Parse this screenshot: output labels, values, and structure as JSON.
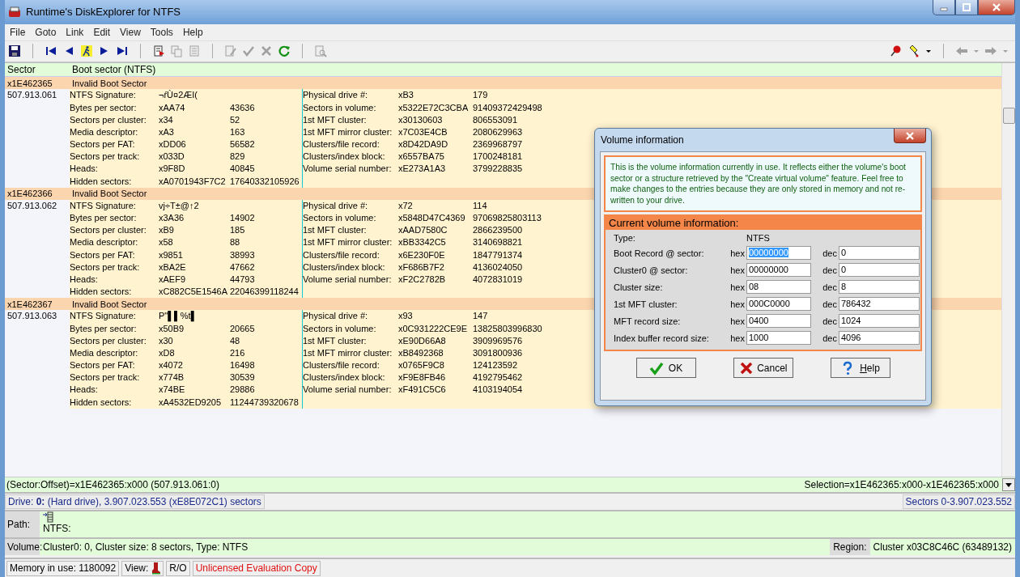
{
  "window": {
    "title": "Runtime's DiskExplorer for NTFS"
  },
  "menu": [
    "File",
    "Goto",
    "Link",
    "Edit",
    "View",
    "Tools",
    "Help"
  ],
  "toolbar": [
    {
      "kind": "save",
      "disabled": false
    },
    {
      "kind": "sep"
    },
    {
      "kind": "first",
      "disabled": false
    },
    {
      "kind": "previous",
      "disabled": false
    },
    {
      "kind": "walker",
      "disabled": false
    },
    {
      "kind": "next",
      "disabled": false
    },
    {
      "kind": "last",
      "disabled": false
    },
    {
      "kind": "sep"
    },
    {
      "kind": "flag-document",
      "disabled": false
    },
    {
      "kind": "copy",
      "disabled": true
    },
    {
      "kind": "grid-document",
      "disabled": true
    },
    {
      "kind": "sep"
    },
    {
      "kind": "edit-document",
      "disabled": true
    },
    {
      "kind": "check",
      "disabled": true
    },
    {
      "kind": "cross",
      "disabled": true
    },
    {
      "kind": "refresh",
      "disabled": false
    },
    {
      "kind": "sep"
    },
    {
      "kind": "search-document",
      "disabled": true
    }
  ],
  "toolbar_right": [
    {
      "kind": "pushpin",
      "disabled": false
    },
    {
      "kind": "marker",
      "disabled": false
    },
    {
      "kind": "caret",
      "disabled": false
    },
    {
      "kind": "sep"
    },
    {
      "kind": "back",
      "disabled": true
    },
    {
      "kind": "caret",
      "disabled": true
    },
    {
      "kind": "forward",
      "disabled": true
    },
    {
      "kind": "caret",
      "disabled": true
    }
  ],
  "table": {
    "columns": [
      "Sector",
      "Boot sector (NTFS)"
    ],
    "groups": [
      {
        "sector_hex": "x1E462365",
        "status": "Invalid Boot Sector",
        "sector_dec": "507.913.061",
        "left": [
          {
            "label": "NTFS Signature:",
            "hex": "¬ŕÙ¤2ÆI("
          },
          {
            "label": "Bytes per sector:",
            "hex": "xAA74",
            "dec": "43636"
          },
          {
            "label": "Sectors per cluster:",
            "hex": "x34",
            "dec": "52"
          },
          {
            "label": "Media descriptor:",
            "hex": "xA3",
            "dec": "163"
          },
          {
            "label": "Sectors per FAT:",
            "hex": "xDD06",
            "dec": "56582"
          },
          {
            "label": "Sectors per track:",
            "hex": "x033D",
            "dec": "829"
          },
          {
            "label": "Heads:",
            "hex": "x9F8D",
            "dec": "40845"
          },
          {
            "label": "Hidden sectors:",
            "hex": "xA0701943F7C2",
            "dec": "17640332105926"
          }
        ],
        "right": [
          {
            "label": "Physical drive #:",
            "hex": "xB3",
            "dec": "179"
          },
          {
            "label": "Sectors in volume:",
            "hex": "x5322E72C3CBA",
            "dec": "91409372429498"
          },
          {
            "label": "1st MFT cluster:",
            "hex": "x30130603",
            "dec": "806553091"
          },
          {
            "label": "1st MFT mirror cluster:",
            "hex": "x7C03E4CB",
            "dec": "2080629963"
          },
          {
            "label": "Clusters/file record:",
            "hex": "x8D42DA9D",
            "dec": "2369968797"
          },
          {
            "label": "Clusters/index block:",
            "hex": "x6557BA75",
            "dec": "1700248181"
          },
          {
            "label": "Volume serial number:",
            "hex": "xE273A1A3",
            "dec": "3799228835"
          }
        ]
      },
      {
        "sector_hex": "x1E462366",
        "status": "Invalid Boot Sector",
        "sector_dec": "507.913.062",
        "left": [
          {
            "label": "NTFS Signature:",
            "hex": "vj÷T±@↑2"
          },
          {
            "label": "Bytes per sector:",
            "hex": "x3A36",
            "dec": "14902"
          },
          {
            "label": "Sectors per cluster:",
            "hex": "xB9",
            "dec": "185"
          },
          {
            "label": "Media descriptor:",
            "hex": "x58",
            "dec": "88"
          },
          {
            "label": "Sectors per FAT:",
            "hex": "x9851",
            "dec": "38993"
          },
          {
            "label": "Sectors per track:",
            "hex": "xBA2E",
            "dec": "47662"
          },
          {
            "label": "Heads:",
            "hex": "xAEF9",
            "dec": "44793"
          },
          {
            "label": "Hidden sectors:",
            "hex": "xC882C5E1546A",
            "dec": "22046399118244"
          }
        ],
        "right": [
          {
            "label": "Physical drive #:",
            "hex": "x72",
            "dec": "114"
          },
          {
            "label": "Sectors in volume:",
            "hex": "x5848D47C4369",
            "dec": "97069825803113"
          },
          {
            "label": "1st MFT cluster:",
            "hex": "xAAD7580C",
            "dec": "2866239500"
          },
          {
            "label": "1st MFT mirror cluster:",
            "hex": "xBB3342C5",
            "dec": "3140698821"
          },
          {
            "label": "Clusters/file record:",
            "hex": "x6E230F0E",
            "dec": "1847791374"
          },
          {
            "label": "Clusters/index block:",
            "hex": "xF686B7F2",
            "dec": "4136024050"
          },
          {
            "label": "Volume serial number:",
            "hex": "xF2C2782B",
            "dec": "4072831019"
          }
        ]
      },
      {
        "sector_hex": "x1E462367",
        "status": "Invalid Boot Sector",
        "sector_dec": "507.913.063",
        "left": [
          {
            "label": "NTFS Signature:",
            "hex": "P\"▌▌%t▌"
          },
          {
            "label": "Bytes per sector:",
            "hex": "x50B9",
            "dec": "20665"
          },
          {
            "label": "Sectors per cluster:",
            "hex": "x30",
            "dec": "48"
          },
          {
            "label": "Media descriptor:",
            "hex": "xD8",
            "dec": "216"
          },
          {
            "label": "Sectors per FAT:",
            "hex": "x4072",
            "dec": "16498"
          },
          {
            "label": "Sectors per track:",
            "hex": "x774B",
            "dec": "30539"
          },
          {
            "label": "Heads:",
            "hex": "x74BE",
            "dec": "29886"
          },
          {
            "label": "Hidden sectors:",
            "hex": "xA4532ED9205",
            "dec": "11244739320678"
          }
        ],
        "right": [
          {
            "label": "Physical drive #:",
            "hex": "x93",
            "dec": "147"
          },
          {
            "label": "Sectors in volume:",
            "hex": "x0C931222CE9E",
            "dec": "13825803996830"
          },
          {
            "label": "1st MFT cluster:",
            "hex": "xE90D66A8",
            "dec": "3909969576"
          },
          {
            "label": "1st MFT mirror cluster:",
            "hex": "xB8492368",
            "dec": "3091800936"
          },
          {
            "label": "Clusters/file record:",
            "hex": "x0765F9C8",
            "dec": "124123592"
          },
          {
            "label": "Clusters/index block:",
            "hex": "xF9E8FB46",
            "dec": "4192795462"
          },
          {
            "label": "Volume serial number:",
            "hex": "xF491C5C6",
            "dec": "4103194054"
          }
        ]
      }
    ]
  },
  "position": {
    "offset": "(Sector:Offset)=x1E462365:x000 (507.913.061:0)",
    "selection": "Selection=x1E462365:x000-x1E462365:x000"
  },
  "drive": {
    "label": "Drive:",
    "number": "0:",
    "info": "(Hard drive), 3.907.023.553 (xE8E072C1) sectors",
    "range": "Sectors 0-3.907.023.552"
  },
  "path": {
    "label": "Path:",
    "value": "NTFS:"
  },
  "volume": {
    "label": "Volume:",
    "value": "Cluster0: 0, Cluster size: 8 sectors, Type: NTFS",
    "region_label": "Region:",
    "region": "Cluster x03C8C46C (63489132)"
  },
  "status_bar": {
    "memory": "Memory in use: 1180092",
    "view": "View:",
    "mode": "R/O",
    "license": "Unlicensed Evaluation Copy"
  },
  "dialog": {
    "title": "Volume information",
    "intro": "This is the volume information currently in use. It reflects either the volume's boot sector or a structure retrieved by the \"Create virtual volume\" feature. Feel free to make changes to the entries because they are only stored in memory and not re-written to your drive.",
    "section": "Current volume information:",
    "type_label": "Type:",
    "type_value": "NTFS",
    "rows": [
      {
        "label": "Boot Record @ sector:",
        "hex_label": "hex",
        "hex": "00000000",
        "dec_label": "dec",
        "dec": "0",
        "selected": true
      },
      {
        "label": "Cluster0 @ sector:",
        "hex_label": "hex",
        "hex": "00000000",
        "dec_label": "dec",
        "dec": "0",
        "selected": false
      },
      {
        "label": "Cluster size:",
        "hex_label": "hex",
        "hex": "08",
        "dec_label": "dec",
        "dec": "8",
        "selected": false
      },
      {
        "label": "1st MFT cluster:",
        "hex_label": "hex",
        "hex": "000C0000",
        "dec_label": "dec",
        "dec": "786432",
        "selected": false
      },
      {
        "label": "MFT record size:",
        "hex_label": "hex",
        "hex": "0400",
        "dec_label": "dec",
        "dec": "1024",
        "selected": false
      },
      {
        "label": "Index buffer record size:",
        "hex_label": "hex",
        "hex": "1000",
        "dec_label": "dec",
        "dec": "4096",
        "selected": false
      }
    ],
    "buttons": [
      {
        "kind": "ok",
        "label": "OK"
      },
      {
        "kind": "cancel",
        "label": "Cancel"
      },
      {
        "kind": "help",
        "label": "Help"
      }
    ]
  }
}
